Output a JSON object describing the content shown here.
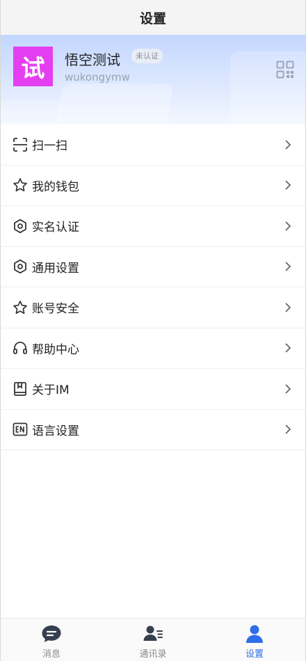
{
  "header": {
    "title": "设置"
  },
  "profile": {
    "avatar_text": "试",
    "avatar_color": "#e43ef0",
    "name": "悟空测试",
    "verify_badge": "未认证",
    "user_id": "wukongymw",
    "qr_icon": "qr-code-icon"
  },
  "menu": {
    "items": [
      {
        "label": "扫一扫",
        "icon": "scan-icon"
      },
      {
        "label": "我的钱包",
        "icon": "star-icon"
      },
      {
        "label": "实名认证",
        "icon": "hexagon-icon"
      },
      {
        "label": "通用设置",
        "icon": "hexagon-icon"
      },
      {
        "label": "账号安全",
        "icon": "star-icon"
      },
      {
        "label": "帮助中心",
        "icon": "headset-icon"
      },
      {
        "label": "关于IM",
        "icon": "book-icon"
      },
      {
        "label": "语言设置",
        "icon": "en-icon"
      }
    ]
  },
  "tabbar": {
    "tabs": [
      {
        "label": "消息",
        "icon": "chat-bubble-icon"
      },
      {
        "label": "通讯录",
        "icon": "contacts-icon"
      },
      {
        "label": "设置",
        "icon": "user-icon",
        "active": true
      }
    ],
    "active_color": "#2f6ee8",
    "inactive_color": "#8a8a8a"
  }
}
